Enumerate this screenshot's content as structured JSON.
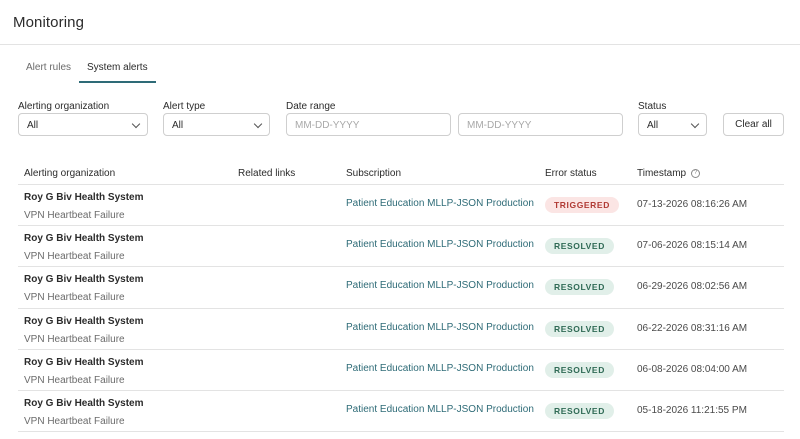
{
  "header": {
    "title": "Monitoring"
  },
  "tabs": [
    {
      "label": "Alert rules",
      "active": false
    },
    {
      "label": "System alerts",
      "active": true
    }
  ],
  "filters": {
    "org_label": "Alerting organization",
    "org_value": "All",
    "type_label": "Alert type",
    "type_value": "All",
    "date_label": "Date range",
    "date_from_placeholder": "MM-DD-YYYY",
    "date_to_placeholder": "MM-DD-YYYY",
    "status_label": "Status",
    "status_value": "All",
    "clear_label": "Clear all"
  },
  "table": {
    "columns": {
      "org": "Alerting organization",
      "links": "Related links",
      "subscription": "Subscription",
      "status": "Error status",
      "timestamp": "Timestamp"
    },
    "timestamp_help_icon": "help-circle-icon",
    "rows": [
      {
        "org": "Roy G Biv Health System",
        "type": "VPN Heartbeat Failure",
        "subscription": "Patient Education MLLP-JSON Production",
        "status": "TRIGGERED",
        "timestamp": "07-13-2026 08:16:26 AM"
      },
      {
        "org": "Roy G Biv Health System",
        "type": "VPN Heartbeat Failure",
        "subscription": "Patient Education MLLP-JSON Production",
        "status": "RESOLVED",
        "timestamp": "07-06-2026 08:15:14 AM"
      },
      {
        "org": "Roy G Biv Health System",
        "type": "VPN Heartbeat Failure",
        "subscription": "Patient Education MLLP-JSON Production",
        "status": "RESOLVED",
        "timestamp": "06-29-2026 08:02:56 AM"
      },
      {
        "org": "Roy G Biv Health System",
        "type": "VPN Heartbeat Failure",
        "subscription": "Patient Education MLLP-JSON Production",
        "status": "RESOLVED",
        "timestamp": "06-22-2026 08:31:16 AM"
      },
      {
        "org": "Roy G Biv Health System",
        "type": "VPN Heartbeat Failure",
        "subscription": "Patient Education MLLP-JSON Production",
        "status": "RESOLVED",
        "timestamp": "06-08-2026 08:04:00 AM"
      },
      {
        "org": "Roy G Biv Health System",
        "type": "VPN Heartbeat Failure",
        "subscription": "Patient Education MLLP-JSON Production",
        "status": "RESOLVED",
        "timestamp": "05-18-2026 11:21:55 PM"
      }
    ]
  },
  "colors": {
    "accent": "#2e6b77",
    "triggered_bg": "#fbe5e4",
    "triggered_fg": "#b03a34",
    "resolved_bg": "#e1efe9",
    "resolved_fg": "#2f6a55"
  }
}
